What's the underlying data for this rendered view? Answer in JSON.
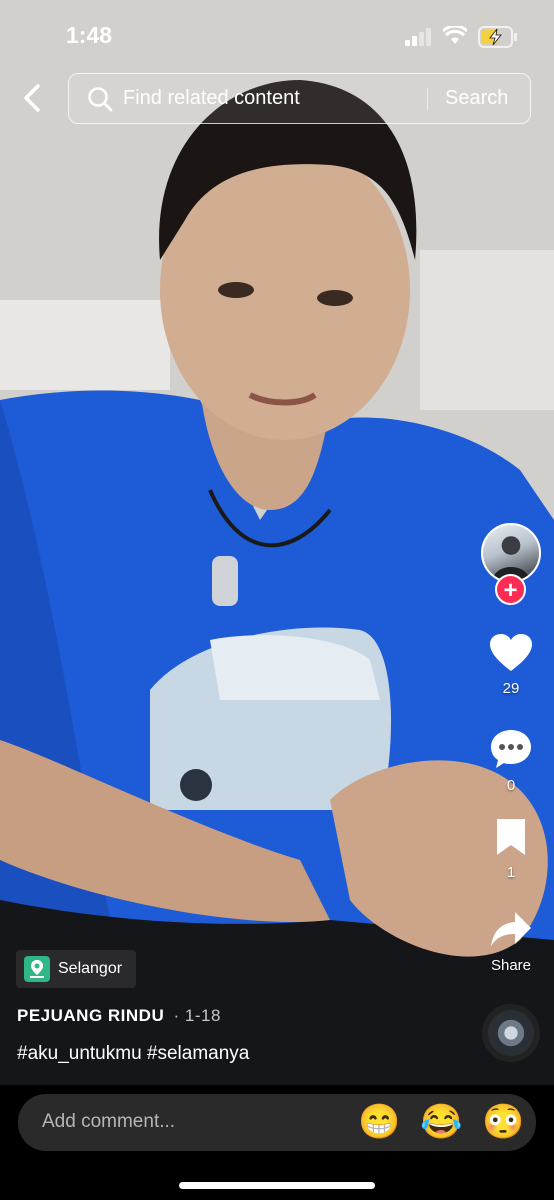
{
  "status_bar": {
    "time": "1:48",
    "signal_icon": "cellular-signal-icon",
    "wifi_icon": "wifi-icon",
    "battery_icon": "battery-charging-icon",
    "battery_color": "#f4d03f"
  },
  "search": {
    "placeholder": "Find related content",
    "submit_label": "Search",
    "back_icon": "chevron-left-icon",
    "search_icon": "magnifier-icon"
  },
  "rail": {
    "follow_symbol": "+",
    "likes": "29",
    "comments": "0",
    "saves": "1",
    "share_label": "Share",
    "accent_color": "#fe2c55"
  },
  "post": {
    "location": "Selangor",
    "author": "PEJUANG RINDU",
    "date": "· 1-18",
    "caption": "#aku_untukmu #selamanya"
  },
  "comment_bar": {
    "placeholder": "Add comment...",
    "emojis": [
      "😁",
      "😂",
      "😳"
    ]
  }
}
